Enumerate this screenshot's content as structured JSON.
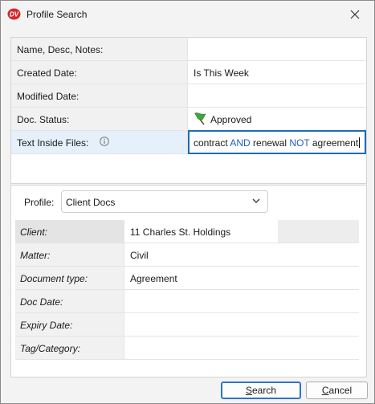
{
  "window": {
    "title": "Profile Search",
    "icon": "dv-logo-icon"
  },
  "criteria": [
    {
      "label": "Name, Desc, Notes:",
      "value": ""
    },
    {
      "label": "Created Date:",
      "value": "Is This Week"
    },
    {
      "label": "Modified Date:",
      "value": ""
    },
    {
      "label": "Doc. Status:",
      "value": "Approved",
      "icon": "green-flag-icon"
    },
    {
      "label": "Text Inside Files:",
      "value": "contract AND renewal NOT agreement",
      "icon": "info-icon",
      "query_parts": [
        "contract ",
        "AND",
        " renewal ",
        "NOT",
        " agreement"
      ]
    }
  ],
  "profile": {
    "label": "Profile:",
    "selected": "Client Docs",
    "fields": [
      {
        "label": "Client:",
        "value": "11 Charles St. Holdings"
      },
      {
        "label": "Matter:",
        "value": "Civil"
      },
      {
        "label": "Document type:",
        "value": "Agreement"
      },
      {
        "label": "Doc Date:",
        "value": ""
      },
      {
        "label": "Expiry Date:",
        "value": ""
      },
      {
        "label": "Tag/Category:",
        "value": ""
      }
    ]
  },
  "buttons": {
    "search": {
      "label": "Search",
      "mnemonic": "S",
      "rest": "earch"
    },
    "cancel": {
      "label": "Cancel",
      "mnemonic": "C",
      "rest": "ancel"
    }
  },
  "colors": {
    "accent": "#1d6cb7",
    "keyword": "#1f5fbf",
    "selected_row": "#e5f0fb"
  }
}
